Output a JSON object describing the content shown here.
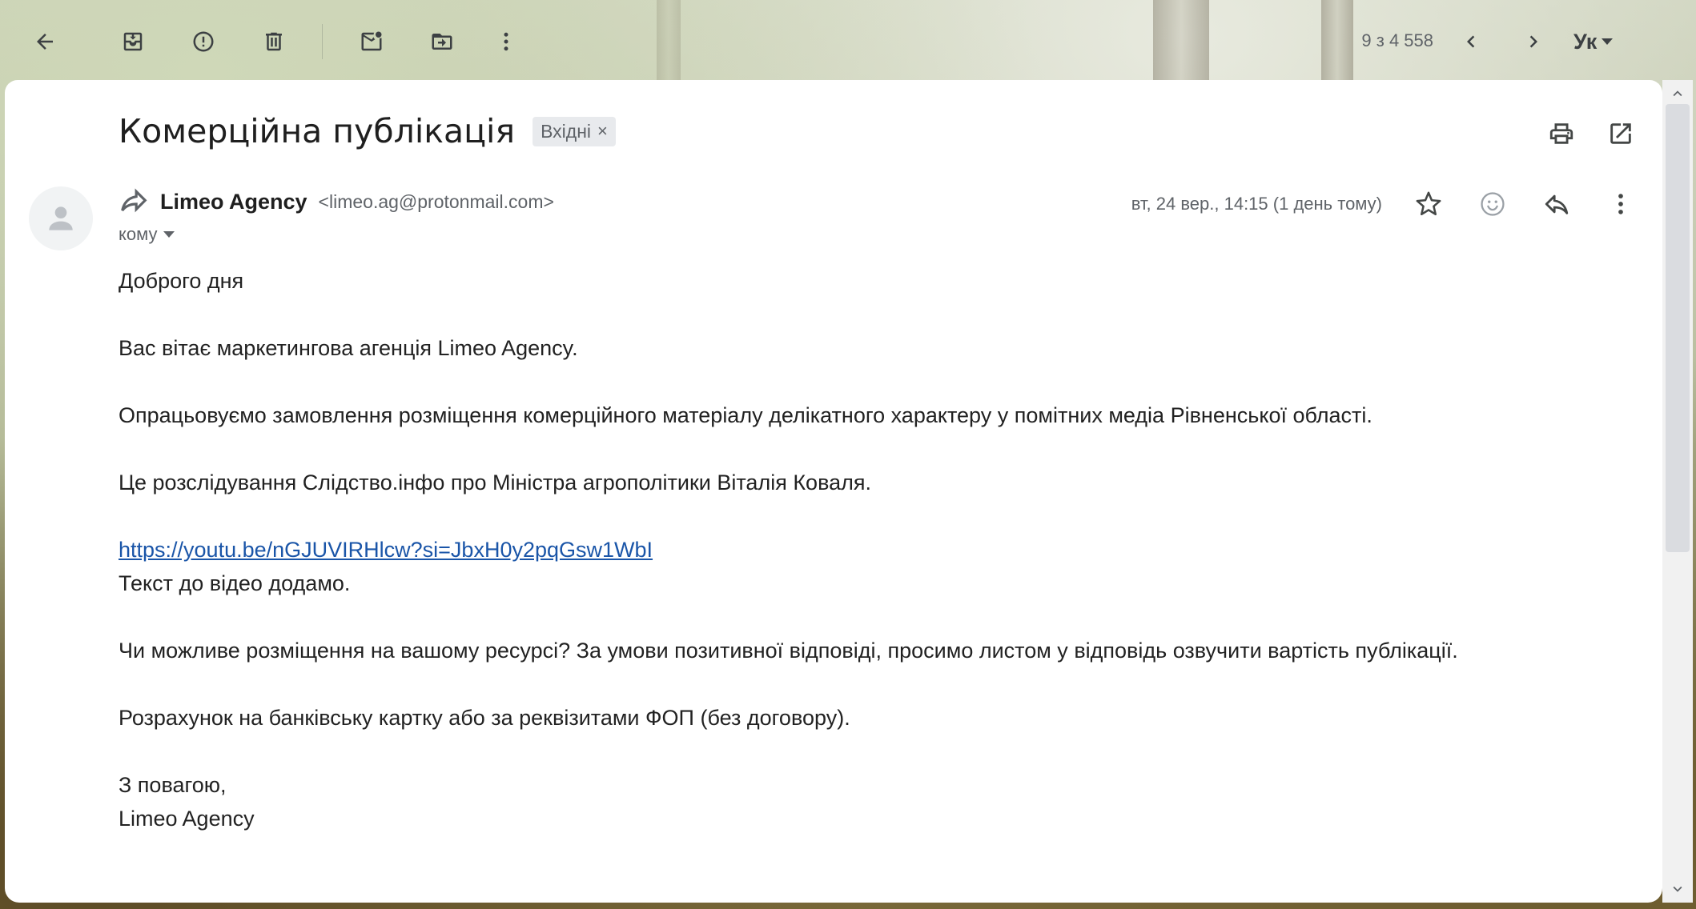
{
  "toolbar": {
    "counter": "9 з 4 558",
    "language": "Ук"
  },
  "email": {
    "subject": "Комерційна публікація",
    "label": "Вхідні",
    "label_close": "×",
    "sender_name": "Limeo Agency",
    "sender_email": "<limeo.ag@protonmail.com>",
    "to_label": "кому",
    "date": "вт, 24 вер., 14:15 (1 день тому)"
  },
  "body": {
    "greeting": "Доброго дня",
    "intro": "Вас вітає маркетингова агенція Limeo Agency.",
    "para1": "Опрацьовуємо замовлення розміщення комерційного матеріалу делікатного характеру у помітних медіа Рівненської області.",
    "para2": "Це розслідування Слідство.інфо про Міністра агрополітики Віталія Коваля.",
    "link": "https://youtu.be/nGJUVIRHlcw?si=JbxH0y2pqGsw1WbI",
    "link_note": "Текст до відео додамо.",
    "para3": "Чи можливе розміщення на вашому ресурсі? За умови позитивної відповіді, просимо листом у відповідь озвучити вартість публікації.",
    "para4": "Розрахунок на банківську картку або за реквізитами ФОП (без договору).",
    "closing": "З повагою,",
    "signature": "Limeo Agency"
  },
  "icons": {
    "back": "arrow-left-icon",
    "archive": "archive-icon",
    "spam": "report-spam-icon",
    "delete": "trash-icon",
    "mark_unread": "mark-unread-icon",
    "move": "move-to-icon",
    "more": "more-vert-icon",
    "prev": "chevron-left-icon",
    "next": "chevron-right-icon",
    "print": "print-icon",
    "open_new": "open-in-new-icon",
    "star": "star-icon",
    "emoji": "emoji-icon",
    "reply": "reply-icon"
  }
}
